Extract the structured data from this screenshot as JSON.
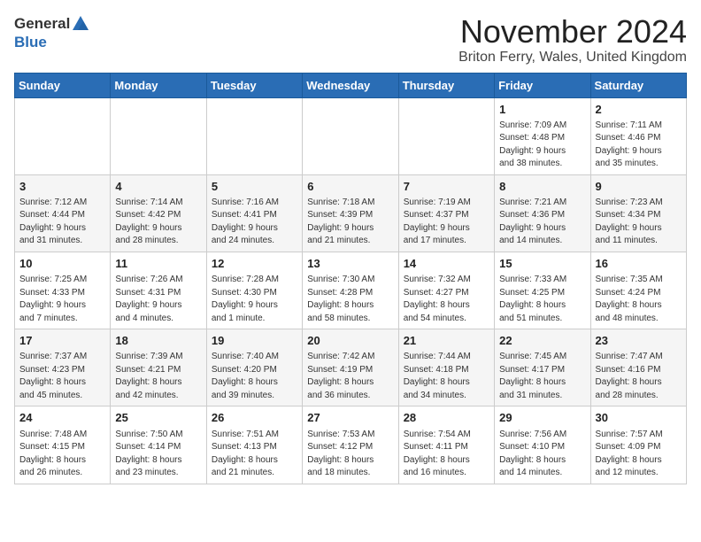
{
  "header": {
    "logo_general": "General",
    "logo_blue": "Blue",
    "month_title": "November 2024",
    "location": "Briton Ferry, Wales, United Kingdom"
  },
  "weekdays": [
    "Sunday",
    "Monday",
    "Tuesday",
    "Wednesday",
    "Thursday",
    "Friday",
    "Saturday"
  ],
  "weeks": [
    [
      {
        "day": "",
        "info": ""
      },
      {
        "day": "",
        "info": ""
      },
      {
        "day": "",
        "info": ""
      },
      {
        "day": "",
        "info": ""
      },
      {
        "day": "",
        "info": ""
      },
      {
        "day": "1",
        "info": "Sunrise: 7:09 AM\nSunset: 4:48 PM\nDaylight: 9 hours\nand 38 minutes."
      },
      {
        "day": "2",
        "info": "Sunrise: 7:11 AM\nSunset: 4:46 PM\nDaylight: 9 hours\nand 35 minutes."
      }
    ],
    [
      {
        "day": "3",
        "info": "Sunrise: 7:12 AM\nSunset: 4:44 PM\nDaylight: 9 hours\nand 31 minutes."
      },
      {
        "day": "4",
        "info": "Sunrise: 7:14 AM\nSunset: 4:42 PM\nDaylight: 9 hours\nand 28 minutes."
      },
      {
        "day": "5",
        "info": "Sunrise: 7:16 AM\nSunset: 4:41 PM\nDaylight: 9 hours\nand 24 minutes."
      },
      {
        "day": "6",
        "info": "Sunrise: 7:18 AM\nSunset: 4:39 PM\nDaylight: 9 hours\nand 21 minutes."
      },
      {
        "day": "7",
        "info": "Sunrise: 7:19 AM\nSunset: 4:37 PM\nDaylight: 9 hours\nand 17 minutes."
      },
      {
        "day": "8",
        "info": "Sunrise: 7:21 AM\nSunset: 4:36 PM\nDaylight: 9 hours\nand 14 minutes."
      },
      {
        "day": "9",
        "info": "Sunrise: 7:23 AM\nSunset: 4:34 PM\nDaylight: 9 hours\nand 11 minutes."
      }
    ],
    [
      {
        "day": "10",
        "info": "Sunrise: 7:25 AM\nSunset: 4:33 PM\nDaylight: 9 hours\nand 7 minutes."
      },
      {
        "day": "11",
        "info": "Sunrise: 7:26 AM\nSunset: 4:31 PM\nDaylight: 9 hours\nand 4 minutes."
      },
      {
        "day": "12",
        "info": "Sunrise: 7:28 AM\nSunset: 4:30 PM\nDaylight: 9 hours\nand 1 minute."
      },
      {
        "day": "13",
        "info": "Sunrise: 7:30 AM\nSunset: 4:28 PM\nDaylight: 8 hours\nand 58 minutes."
      },
      {
        "day": "14",
        "info": "Sunrise: 7:32 AM\nSunset: 4:27 PM\nDaylight: 8 hours\nand 54 minutes."
      },
      {
        "day": "15",
        "info": "Sunrise: 7:33 AM\nSunset: 4:25 PM\nDaylight: 8 hours\nand 51 minutes."
      },
      {
        "day": "16",
        "info": "Sunrise: 7:35 AM\nSunset: 4:24 PM\nDaylight: 8 hours\nand 48 minutes."
      }
    ],
    [
      {
        "day": "17",
        "info": "Sunrise: 7:37 AM\nSunset: 4:23 PM\nDaylight: 8 hours\nand 45 minutes."
      },
      {
        "day": "18",
        "info": "Sunrise: 7:39 AM\nSunset: 4:21 PM\nDaylight: 8 hours\nand 42 minutes."
      },
      {
        "day": "19",
        "info": "Sunrise: 7:40 AM\nSunset: 4:20 PM\nDaylight: 8 hours\nand 39 minutes."
      },
      {
        "day": "20",
        "info": "Sunrise: 7:42 AM\nSunset: 4:19 PM\nDaylight: 8 hours\nand 36 minutes."
      },
      {
        "day": "21",
        "info": "Sunrise: 7:44 AM\nSunset: 4:18 PM\nDaylight: 8 hours\nand 34 minutes."
      },
      {
        "day": "22",
        "info": "Sunrise: 7:45 AM\nSunset: 4:17 PM\nDaylight: 8 hours\nand 31 minutes."
      },
      {
        "day": "23",
        "info": "Sunrise: 7:47 AM\nSunset: 4:16 PM\nDaylight: 8 hours\nand 28 minutes."
      }
    ],
    [
      {
        "day": "24",
        "info": "Sunrise: 7:48 AM\nSunset: 4:15 PM\nDaylight: 8 hours\nand 26 minutes."
      },
      {
        "day": "25",
        "info": "Sunrise: 7:50 AM\nSunset: 4:14 PM\nDaylight: 8 hours\nand 23 minutes."
      },
      {
        "day": "26",
        "info": "Sunrise: 7:51 AM\nSunset: 4:13 PM\nDaylight: 8 hours\nand 21 minutes."
      },
      {
        "day": "27",
        "info": "Sunrise: 7:53 AM\nSunset: 4:12 PM\nDaylight: 8 hours\nand 18 minutes."
      },
      {
        "day": "28",
        "info": "Sunrise: 7:54 AM\nSunset: 4:11 PM\nDaylight: 8 hours\nand 16 minutes."
      },
      {
        "day": "29",
        "info": "Sunrise: 7:56 AM\nSunset: 4:10 PM\nDaylight: 8 hours\nand 14 minutes."
      },
      {
        "day": "30",
        "info": "Sunrise: 7:57 AM\nSunset: 4:09 PM\nDaylight: 8 hours\nand 12 minutes."
      }
    ]
  ]
}
